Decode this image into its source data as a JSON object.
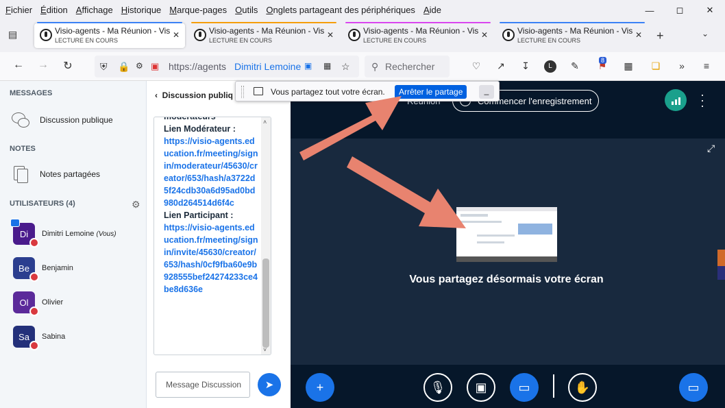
{
  "menubar": {
    "items": [
      "Fichier",
      "Édition",
      "Affichage",
      "Historique",
      "Marque-pages",
      "Outils",
      "Onglets partageant des périphériques",
      "Aide"
    ]
  },
  "tabs": [
    {
      "title": "Visio-agents - Ma Réunion - Vis",
      "subtitle": "LECTURE EN COURS",
      "color": "#3b82f6"
    },
    {
      "title": "Visio-agents - Ma Réunion - Vis",
      "subtitle": "LECTURE EN COURS",
      "color": "#f59e0b"
    },
    {
      "title": "Visio-agents - Ma Réunion - Vis",
      "subtitle": "LECTURE EN COURS",
      "color": "#d946ef"
    },
    {
      "title": "Visio-agents - Ma Réunion - Vis",
      "subtitle": "LECTURE EN COURS",
      "color": "#3b82f6"
    }
  ],
  "urlbar": {
    "url": "https://agents",
    "pip_name": "Dimitri Lemoine"
  },
  "searchbar": {
    "placeholder": "Rechercher"
  },
  "extensions": {
    "badge": "8"
  },
  "sidebar": {
    "messages_title": "MESSAGES",
    "public_chat": "Discussion publique",
    "notes_title": "NOTES",
    "shared_notes": "Notes partagées",
    "users_title": "UTILISATEURS (4)",
    "users": [
      {
        "initials": "Di",
        "name": "Dimitri Lemoine",
        "suffix": "(Vous)",
        "color": "#4a1b8c"
      },
      {
        "initials": "Be",
        "name": "Benjamin",
        "suffix": "",
        "color": "#2b3e8f"
      },
      {
        "initials": "Ol",
        "name": "Olivier",
        "suffix": "",
        "color": "#5b2a9a"
      },
      {
        "initials": "Sa",
        "name": "Sabina",
        "suffix": "",
        "color": "#23307a"
      }
    ]
  },
  "chat": {
    "header": "Discussion publiq",
    "line_top": "modérateurs",
    "mod_label": "Lien Modérateur :",
    "mod_link": "https://visio-agents.education.fr/meeting/signin/moderateur/45630/creator/653/hash/a3722d5f24cdb30a6d95ad0bd980d264514d6f4c",
    "part_label": "Lien Participant :",
    "part_link": "https://visio-agents.education.fr/meeting/signin/invite/45630/creator/653/hash/0cf9fba60e9b928555bef24274233ce4be8d636e",
    "input_placeholder": "Message Discussion"
  },
  "meeting": {
    "partial_label": "Réunion",
    "record_label": "Commencer l'enregistrement",
    "share_status": "Vous partagez désormais votre écran"
  },
  "sharebar": {
    "text": "Vous partagez tout votre écran.",
    "stop_label": "Arrêter le partage",
    "minimize_label": "_"
  },
  "colors": {
    "accent": "#1a73e8",
    "annotation_arrow": "#e8836f",
    "stage_bg": "#18293e",
    "app_bg": "#06172a"
  }
}
